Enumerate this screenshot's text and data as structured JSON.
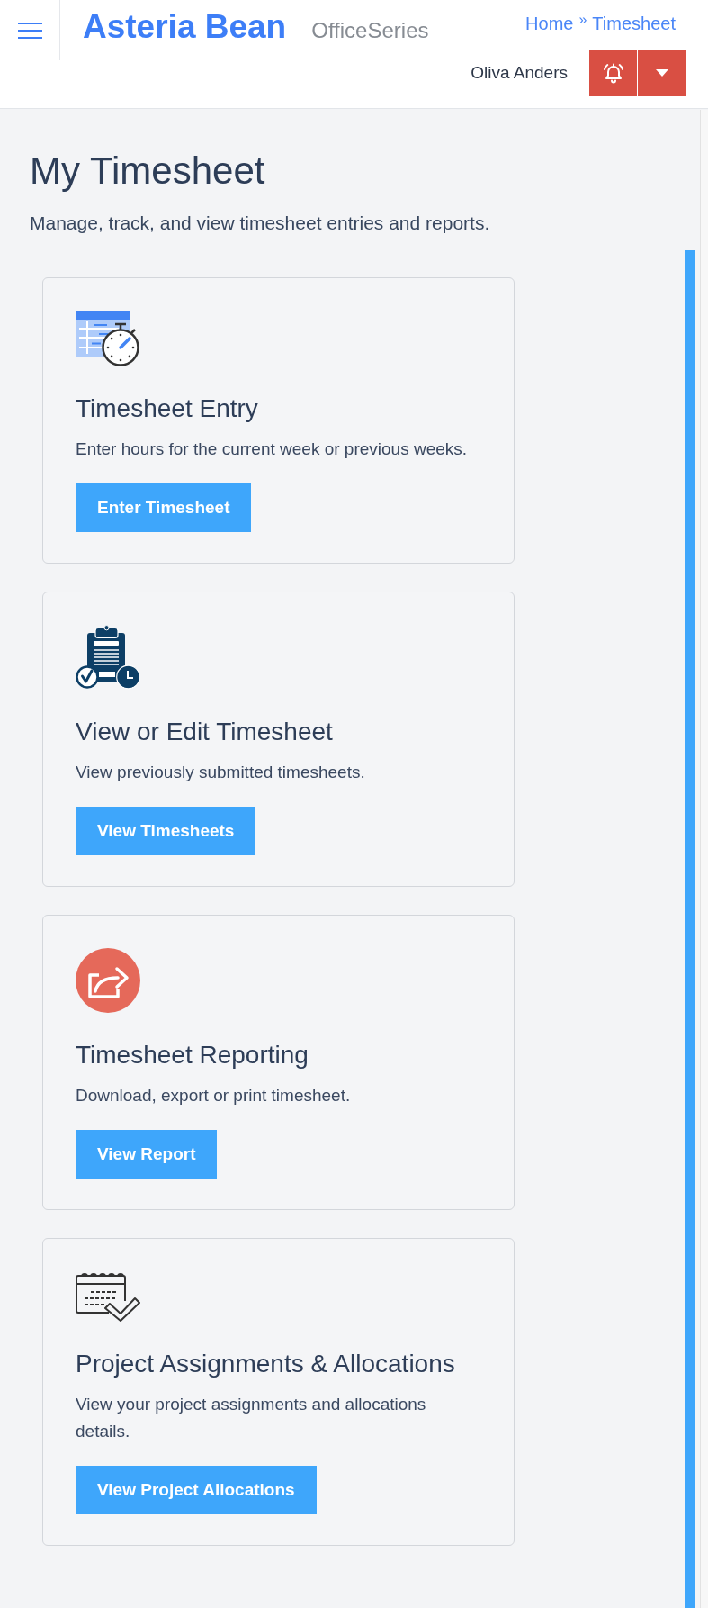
{
  "header": {
    "brand": "Asteria Bean",
    "product": "OfficeSeries",
    "breadcrumb": {
      "items": [
        {
          "label": "Home"
        },
        {
          "label": "Timesheet"
        }
      ],
      "separator": "»"
    },
    "user_name": "Oliva Anders"
  },
  "page": {
    "title": "My Timesheet",
    "subtitle": "Manage, track, and view timesheet entries and reports."
  },
  "cards": [
    {
      "kind": "entry",
      "title": "Timesheet Entry",
      "description": "Enter hours for the current week or previous weeks.",
      "button": "Enter Timesheet"
    },
    {
      "kind": "review",
      "title": "View or Edit Timesheet",
      "description": "View previously submitted timesheets.",
      "button": "View Timesheets"
    },
    {
      "kind": "reporting",
      "title": "Timesheet Reporting",
      "description": "Download, export or print timesheet.",
      "button": "View Report"
    },
    {
      "kind": "allocations",
      "title": "Project Assignments & Allocations",
      "description": "View your project assignments and allocations details.",
      "button": "View Project Allocations"
    }
  ]
}
